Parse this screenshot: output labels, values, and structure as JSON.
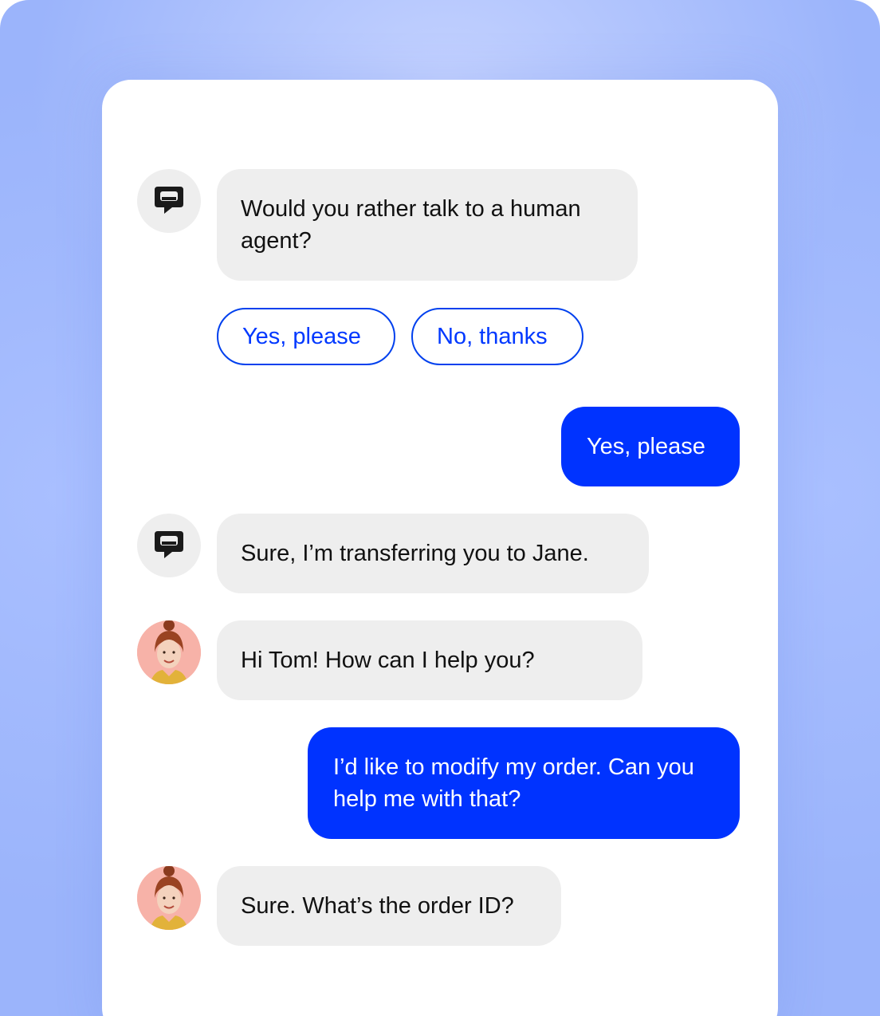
{
  "conversation": {
    "bot_question": "Would you rather talk to a human agent?",
    "quick_replies": [
      "Yes, please",
      "No, thanks"
    ],
    "user_reply_1": "Yes, please",
    "bot_transfer": "Sure, I’m transferring you to Jane.",
    "agent_greeting": "Hi Tom! How can I help you?",
    "user_reply_2": "I’d like to modify my order. Can you help me with that?",
    "agent_followup": "Sure. What’s the order ID?"
  },
  "icons": {
    "bot_avatar": "chat-bubble-logo-icon",
    "agent_avatar": "agent-avatar"
  },
  "colors": {
    "accent": "#0033ff",
    "bubble_gray": "#eeeeee",
    "backdrop": "#9bb4fb"
  }
}
